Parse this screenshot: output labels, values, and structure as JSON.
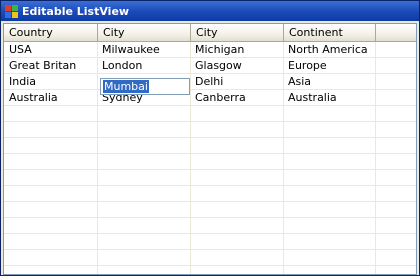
{
  "window": {
    "title": "Editable ListView"
  },
  "listview": {
    "columns": [
      "Country",
      "City",
      "City",
      "Continent",
      ""
    ],
    "rows": [
      [
        "USA",
        "Milwaukee",
        "Michigan",
        "North America"
      ],
      [
        "Great Britan",
        "London",
        "Glasgow",
        "Europe"
      ],
      [
        "India",
        "",
        "Delhi",
        "Asia"
      ],
      [
        "Australia",
        "Sydney",
        "Canberra",
        "Australia"
      ]
    ],
    "editing": {
      "row": 2,
      "column": 1,
      "value": "Mumbai"
    }
  },
  "icons": {
    "app": "app-window-icon"
  },
  "colors": {
    "titlebar": "#1d4cb8",
    "selection": "#316ac5",
    "grid": "#ece9d8"
  }
}
